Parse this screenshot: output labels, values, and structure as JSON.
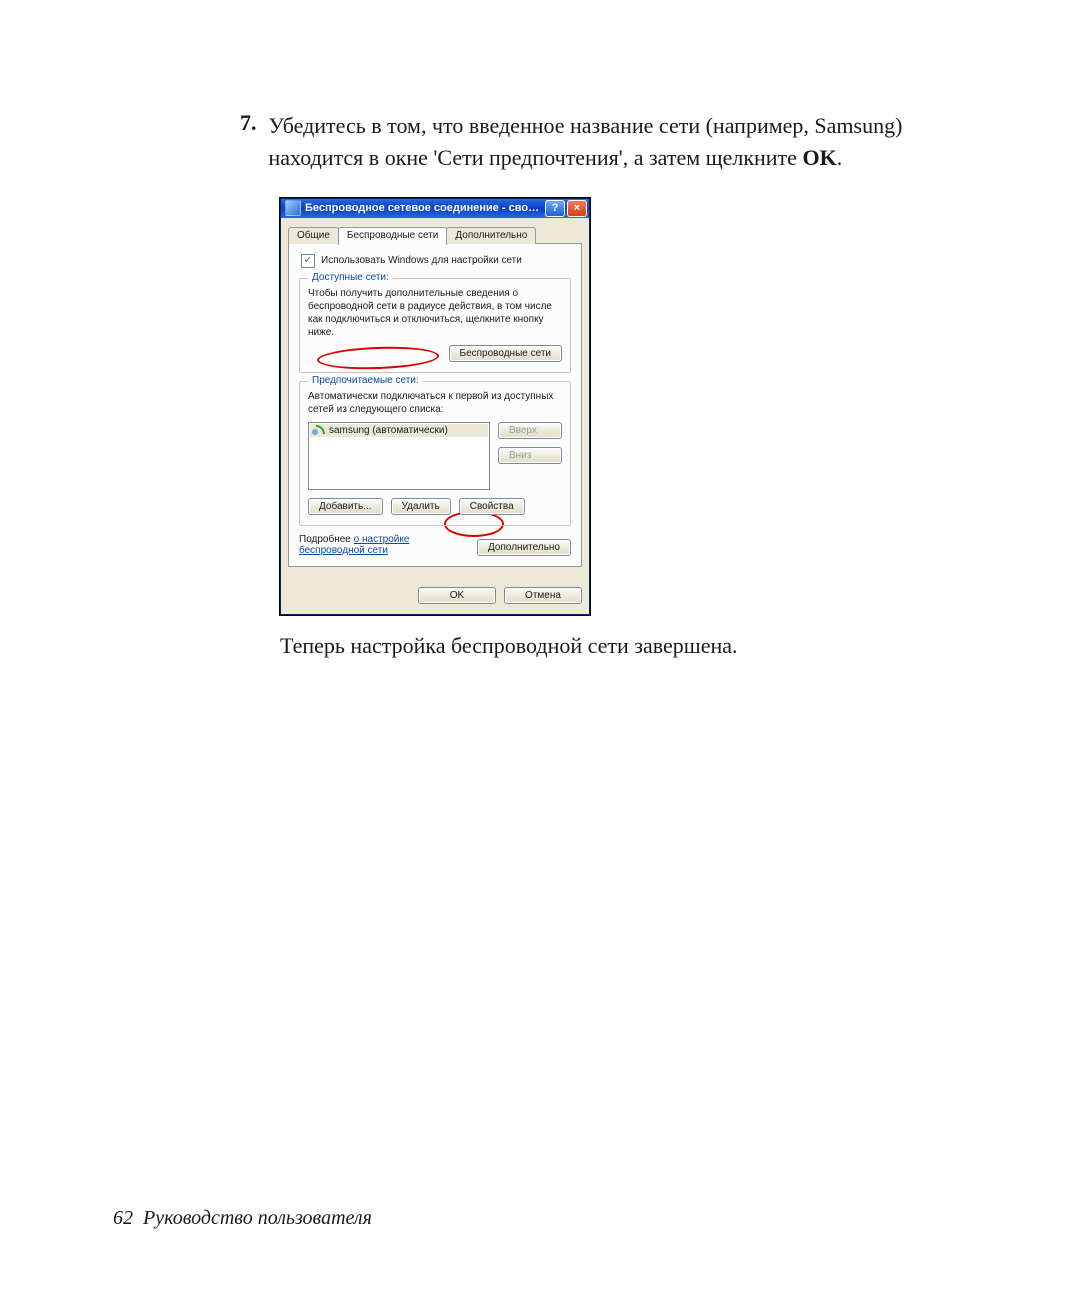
{
  "step": {
    "num": "7.",
    "text_a": "Убедитесь в том, что введенное название сети (например, Samsung) находится в окне 'Сети предпочтения', а затем щелкните ",
    "text_b": "OK",
    "text_c": "."
  },
  "dialog": {
    "title": "Беспроводное сетевое соединение - свой...",
    "help": "?",
    "close": "×",
    "tabs": {
      "general": "Общие",
      "wireless": "Беспроводные сети",
      "advanced": "Дополнительно"
    },
    "use_windows": "Использовать Windows для настройки сети",
    "avail": {
      "legend": "Доступные сети:",
      "text": "Чтобы получить дополнительные сведения о беспроводной сети в радиусе действия, в том числе как подключиться и отключиться, щелкните кнопку ниже.",
      "btn": "Беспроводные сети"
    },
    "pref": {
      "legend": "Предпочитаемые сети:",
      "text": "Автоматически подключаться к первой из доступных сетей из следующего списка:",
      "item": "samsung (автоматически)",
      "up": "Вверх",
      "down": "Вниз",
      "add": "Добавить...",
      "remove": "Удалить",
      "props": "Свойства"
    },
    "more": {
      "text": "Подробнее ",
      "link": "о настройке беспроводной сети",
      "btn": "Дополнительно"
    },
    "ok": "OK",
    "cancel": "Отмена"
  },
  "closing": "Теперь настройка беспроводной сети завершена.",
  "footer": {
    "page": "62",
    "label": "Руководство пользователя"
  }
}
